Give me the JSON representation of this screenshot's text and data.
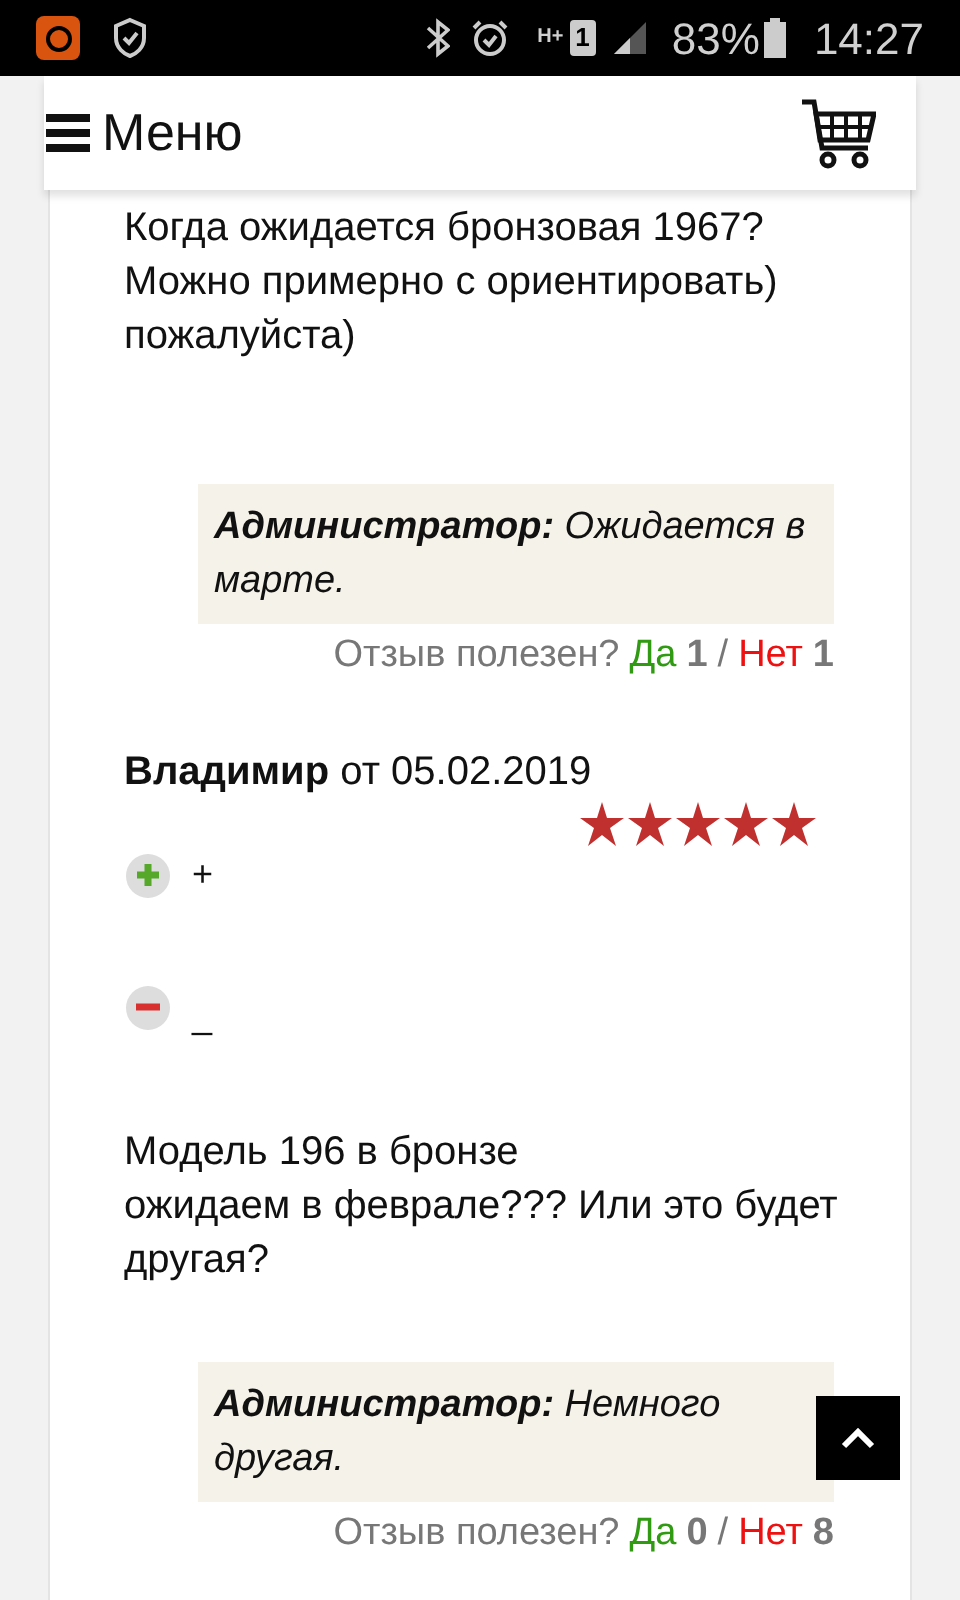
{
  "status_bar": {
    "network": "H+",
    "sim": "1",
    "battery": "83%",
    "time": "14:27"
  },
  "header": {
    "menu_label": "Меню"
  },
  "reviews": [
    {
      "text_lines": [
        "Когда ожидается бронзовая 1967? Можно примерно с ориентировать) пожалуйста)"
      ],
      "reply": {
        "author": "Администратор:",
        "text": "Ожидается в марте."
      },
      "helpful": {
        "question": "Отзыв полезен?",
        "yes": "Да",
        "yes_count": "1",
        "separator": "/",
        "no": "Нет",
        "no_count": "1"
      }
    },
    {
      "author": "Владимир",
      "date": "от 05.02.2019",
      "stars": 5,
      "pros": "+",
      "cons": "_",
      "text_lines": [
        "Модель 196 в бронзе",
        "ожидаем в феврале??? Или это будет другая?"
      ],
      "reply": {
        "author": "Администратор:",
        "text": "Немного другая."
      },
      "helpful": {
        "question": "Отзыв полезен?",
        "yes": "Да",
        "yes_count": "0",
        "separator": "/",
        "no": "Нет",
        "no_count": "8"
      }
    }
  ]
}
